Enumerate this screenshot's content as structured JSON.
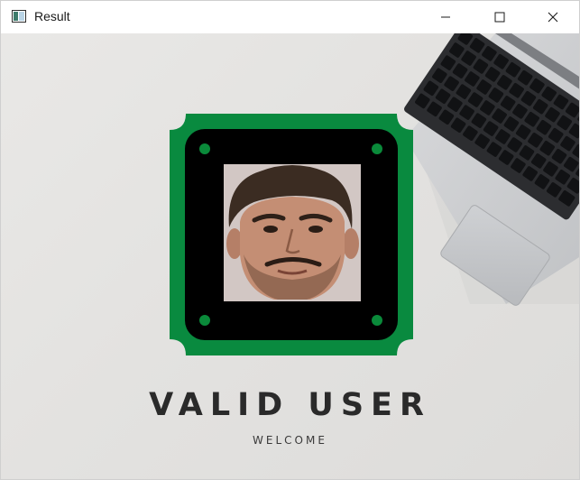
{
  "window": {
    "title": "Result",
    "icon": "app-window-icon",
    "controls": {
      "minimize": "minimize-icon",
      "maximize": "maximize-icon",
      "close": "close-icon"
    }
  },
  "content": {
    "heading": "VALID USER",
    "subheading": "WELCOME"
  },
  "colors": {
    "badge_frame": "#098a3f",
    "badge_inner": "#000000",
    "badge_dots": "#0a8a3a",
    "heading": "#2a2a2a",
    "background": "#e6e5e3"
  }
}
